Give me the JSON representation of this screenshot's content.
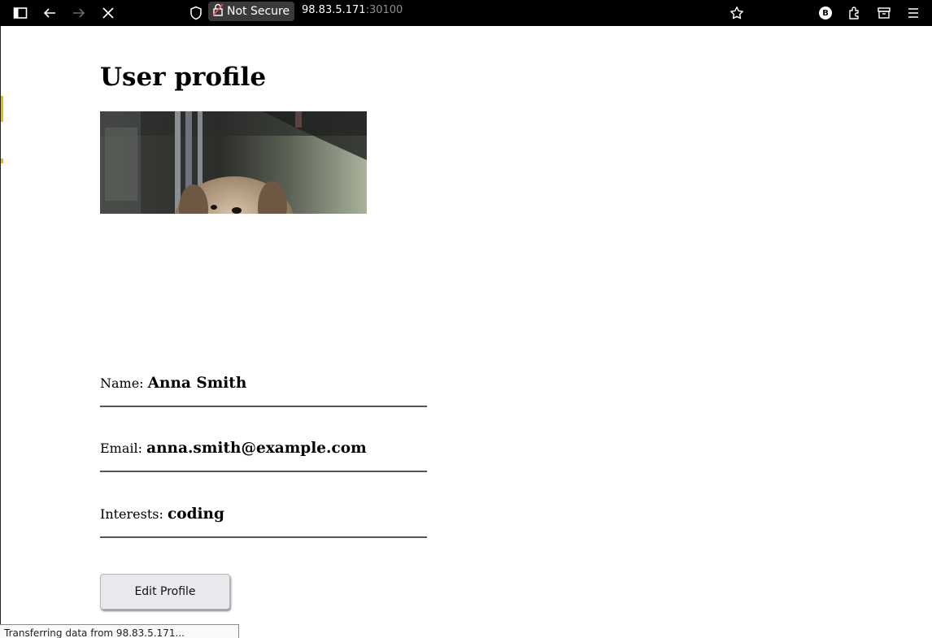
{
  "browser": {
    "security_label": "Not Secure",
    "url_host": "98.83.5.171",
    "url_port": ":30100",
    "account_badge": "B",
    "icons": [
      "sidebar-icon",
      "back-arrow-icon",
      "forward-arrow-icon",
      "stop-icon",
      "shield-icon",
      "lock-warning-icon",
      "star-icon",
      "extensions-icon",
      "container-icon",
      "menu-icon"
    ]
  },
  "page": {
    "title": "User profile",
    "avatar_alt": "dog photo",
    "fields": [
      {
        "label": "Name:",
        "value": "Anna Smith"
      },
      {
        "label": "Email:",
        "value": "anna.smith@example.com"
      },
      {
        "label": "Interests:",
        "value": "coding"
      }
    ],
    "edit_button": "Edit Profile"
  },
  "status": {
    "text": "Transferring data from 98.83.5.171..."
  },
  "colors": {
    "toolbar_bg": "#000000",
    "button_bg": "#e9e9ed",
    "rule": "#555555"
  }
}
